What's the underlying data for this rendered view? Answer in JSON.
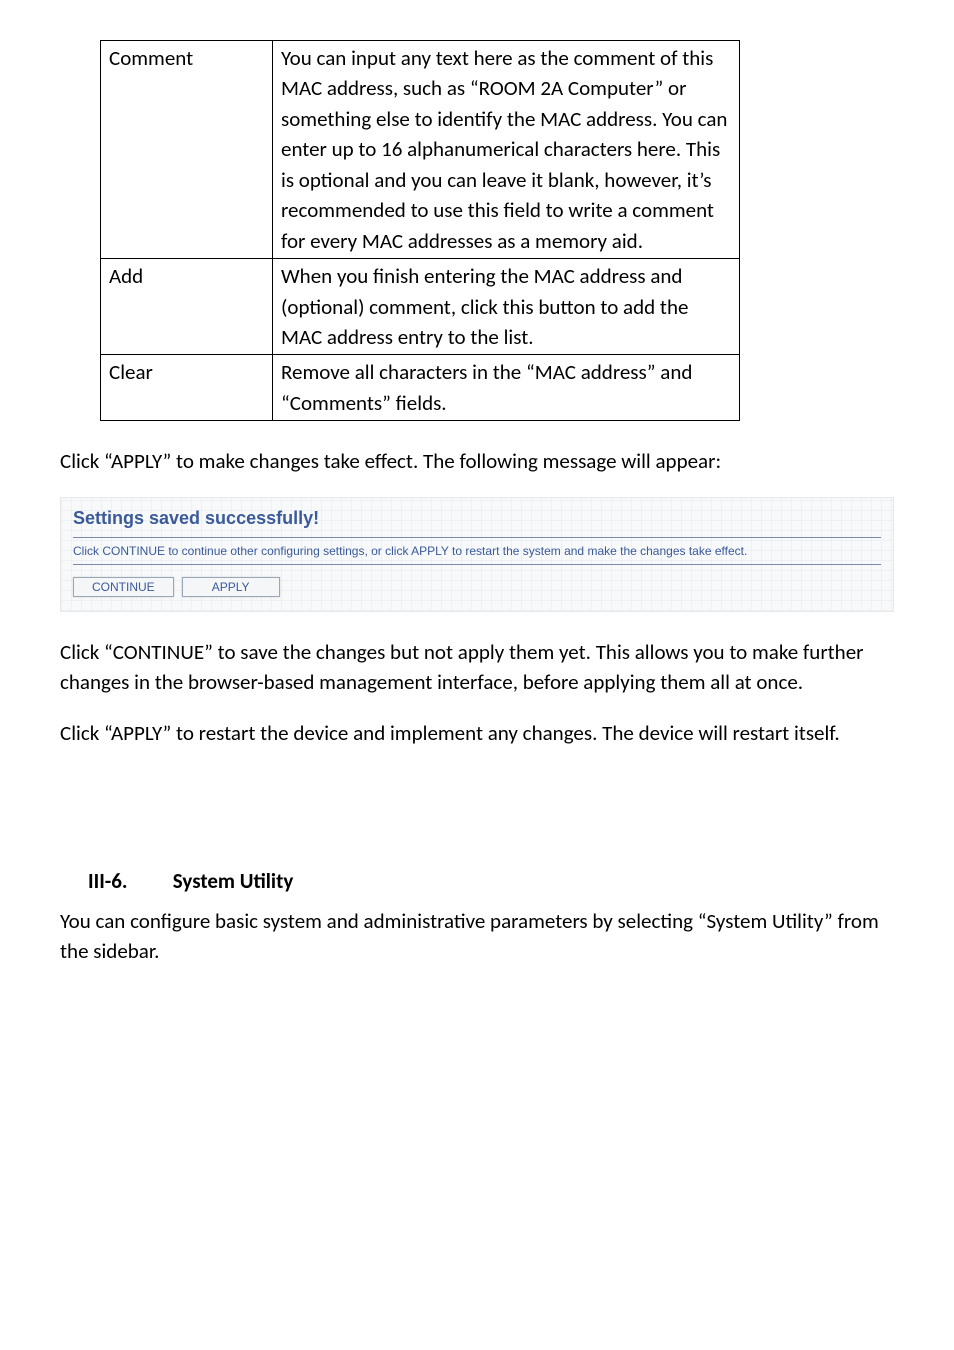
{
  "table": {
    "rows": [
      {
        "term": "Comment",
        "desc": "You can input any text here as the comment of this MAC address, such as “ROOM 2A Computer” or something else to identify the MAC address. You can enter up to 16 alphanumerical characters here. This is optional and you can leave it blank, however, it’s recommended to use this field to write a comment for every MAC addresses as a memory aid."
      },
      {
        "term": "Add",
        "desc": "When you finish entering the MAC address and (optional) comment, click this button to add the MAC address entry to the list."
      },
      {
        "term": "Clear",
        "desc": "Remove all characters in the “MAC address” and “Comments” fields."
      }
    ]
  },
  "para_apply_changes": "Click “APPLY” to make changes take effect. The following message will appear:",
  "panel": {
    "heading": "Settings saved successfully!",
    "subtext": "Click CONTINUE to continue other configuring settings, or click APPLY to restart the system and make the changes take effect.",
    "continue_label": "CONTINUE",
    "apply_label": "APPLY"
  },
  "para_continue": "Click “CONTINUE” to save the changes but not apply them yet. This allows you to make further changes in the browser-based management interface, before applying them all at once.",
  "para_apply_restart": "Click “APPLY” to restart the device and implement any changes. The device will restart itself.",
  "section": {
    "number": "III-6.",
    "title": "System Utility"
  },
  "para_section": "You can configure basic system and administrative parameters by selecting “System Utility” from the sidebar."
}
